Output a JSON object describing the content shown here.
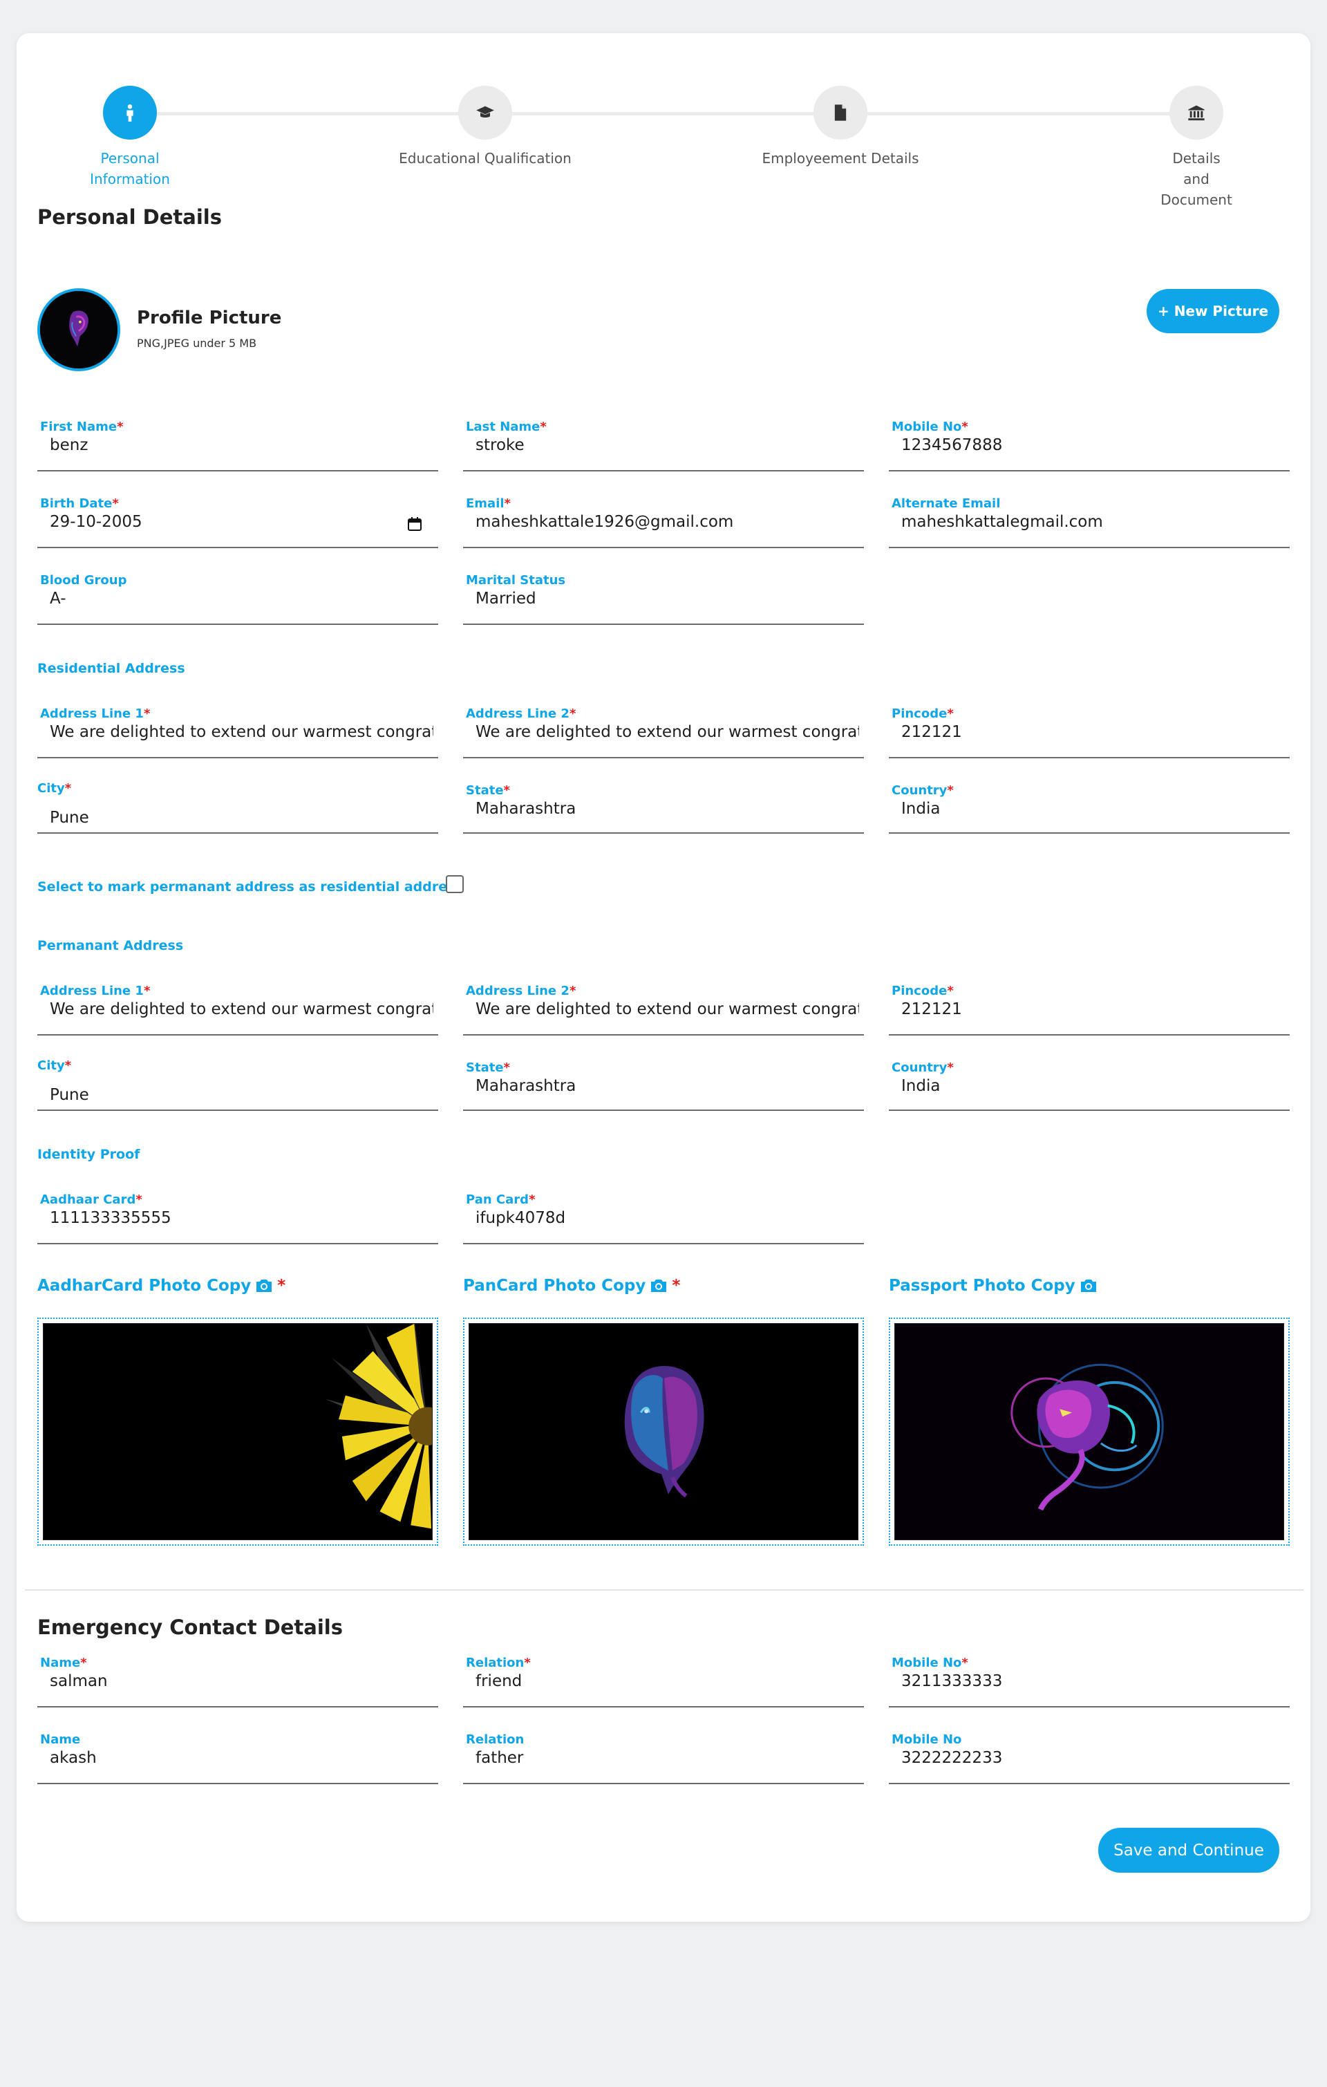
{
  "stepper": {
    "steps": [
      {
        "label_line1": "Personal",
        "label_line2": "Information",
        "icon": "person-icon",
        "active": true
      },
      {
        "label_line1": "Educational Qualification",
        "label_line2": "",
        "icon": "graduation-cap-icon",
        "active": false
      },
      {
        "label_line1": "Employeement Details",
        "label_line2": "",
        "icon": "document-icon",
        "active": false
      },
      {
        "label_line1": "Details",
        "label_line2": "and",
        "label_line3": "Document",
        "icon": "bank-icon",
        "active": false
      }
    ]
  },
  "personal": {
    "title": "Personal Details",
    "profile_title": "Profile Picture",
    "profile_sub": "PNG,JPEG under 5 MB",
    "new_picture_label": "+ New Picture",
    "first_name": {
      "label": "First Name",
      "value": "benz"
    },
    "last_name": {
      "label": "Last Name",
      "value": "stroke"
    },
    "mobile": {
      "label": "Mobile No",
      "value": "1234567888"
    },
    "birth_date": {
      "label": "Birth Date",
      "value": "29-10-2005"
    },
    "email": {
      "label": "Email",
      "value": "maheshkattale1926@gmail.com"
    },
    "alt_email": {
      "label": "Alternate Email",
      "value": "maheshkattalegmail.com"
    },
    "blood_group": {
      "label": "Blood Group",
      "value": "A-"
    },
    "marital_status": {
      "label": "Marital Status",
      "value": "Married"
    }
  },
  "residential": {
    "title": "Residential Address",
    "address1": {
      "label": "Address Line 1",
      "value": "We are delighted to extend our warmest congratu"
    },
    "address2": {
      "label": "Address Line 2",
      "value": "We are delighted to extend our warmest congratu"
    },
    "pincode": {
      "label": "Pincode",
      "value": "212121"
    },
    "city": {
      "label": "City",
      "value": "Pune"
    },
    "state": {
      "label": "State",
      "value": "Maharashtra"
    },
    "country": {
      "label": "Country",
      "value": "India"
    }
  },
  "same_address_label": "Select to mark permanant address as residential address",
  "permanent": {
    "title": "Permanant Address",
    "address1": {
      "label": "Address Line 1",
      "value": "We are delighted to extend our warmest congratu"
    },
    "address2": {
      "label": "Address Line 2",
      "value": "We are delighted to extend our warmest congratu"
    },
    "pincode": {
      "label": "Pincode",
      "value": "212121"
    },
    "city": {
      "label": "City",
      "value": "Pune"
    },
    "state": {
      "label": "State",
      "value": "Maharashtra"
    },
    "country": {
      "label": "Country",
      "value": "India"
    }
  },
  "identity": {
    "title": "Identity Proof",
    "aadhaar": {
      "label": "Aadhaar Card",
      "value": "111133335555"
    },
    "pan": {
      "label": "Pan Card",
      "value": "ifupk4078d"
    },
    "aadhar_photo_label": "AadharCard Photo Copy",
    "pan_photo_label": "PanCard Photo Copy",
    "passport_photo_label": "Passport Photo Copy"
  },
  "emergency": {
    "title": "Emergency Contact Details",
    "name1": {
      "label": "Name",
      "value": "salman"
    },
    "relation1": {
      "label": "Relation",
      "value": "friend"
    },
    "mobile1": {
      "label": "Mobile No",
      "value": "3211333333"
    },
    "name2": {
      "label": "Name",
      "value": "akash"
    },
    "relation2": {
      "label": "Relation",
      "value": "father"
    },
    "mobile2": {
      "label": "Mobile No",
      "value": "3222222233"
    }
  },
  "save_label": "Save and Continue",
  "colors": {
    "accent": "#0fa5e6",
    "required": "#e0201e",
    "background": "#eff0f2"
  }
}
